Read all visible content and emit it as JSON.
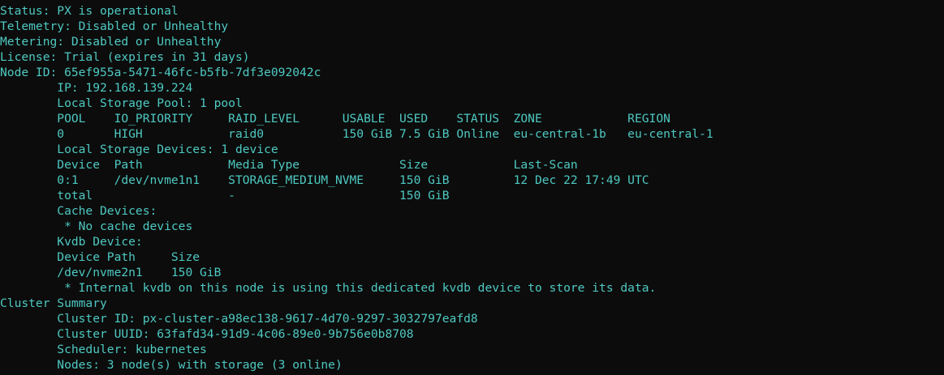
{
  "terminal": {
    "text_color": "#4ec9c2",
    "background": "#0c0c0c",
    "lines": [
      "Status: PX is operational",
      "Telemetry: Disabled or Unhealthy",
      "Metering: Disabled or Unhealthy",
      "License: Trial (expires in 31 days)",
      "Node ID: 65ef955a-5471-46fc-b5fb-7df3e092042c",
      "        IP: 192.168.139.224",
      "        Local Storage Pool: 1 pool",
      "        POOL    IO_PRIORITY     RAID_LEVEL      USABLE  USED    STATUS  ZONE            REGION",
      "        0       HIGH            raid0           150 GiB 7.5 GiB Online  eu-central-1b   eu-central-1",
      "        Local Storage Devices: 1 device",
      "        Device  Path            Media Type              Size            Last-Scan",
      "        0:1     /dev/nvme1n1    STORAGE_MEDIUM_NVME     150 GiB         12 Dec 22 17:49 UTC",
      "        total                   -                       150 GiB",
      "        Cache Devices:",
      "         * No cache devices",
      "        Kvdb Device:",
      "        Device Path     Size",
      "        /dev/nvme2n1    150 GiB",
      "         * Internal kvdb on this node is using this dedicated kvdb device to store its data.",
      "Cluster Summary",
      "        Cluster ID: px-cluster-a98ec138-9617-4d70-9297-3032797eafd8",
      "        Cluster UUID: 63fafd34-91d9-4c06-89e0-9b756e0b8708",
      "        Scheduler: kubernetes",
      "        Nodes: 3 node(s) with storage (3 online)"
    ]
  }
}
